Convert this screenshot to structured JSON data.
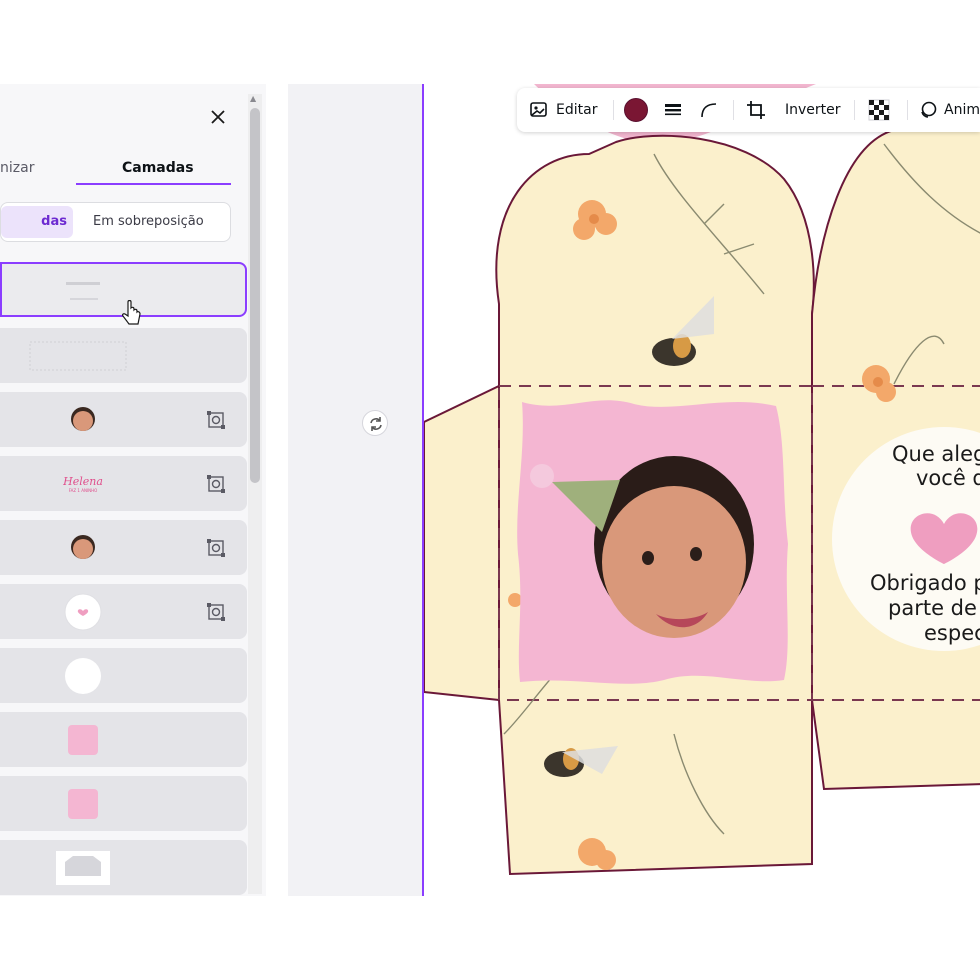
{
  "panel": {
    "tabs": [
      {
        "label": "nizar"
      },
      {
        "label": "Camadas"
      }
    ],
    "segments": [
      {
        "label": "das"
      },
      {
        "label": "Em sobreposição"
      }
    ],
    "more_label": "•••"
  },
  "toolbar": {
    "edit_label": "Editar",
    "color_swatch": "#7a1633",
    "flip_label": "Inverter",
    "animate_label": "Anim"
  },
  "design": {
    "greeting_line1": "Que aleg",
    "greeting_line2": "você d",
    "thanks_line1": "Obrigado p",
    "thanks_line2": "parte de",
    "thanks_line3": "espec",
    "layer_thumb_name": "Helena",
    "layer_thumb_sub": "FAZ 1 ANINHO"
  },
  "colors": {
    "accent": "#8b3dff",
    "pink": "#f4b6d2",
    "cream": "#fbf0cc",
    "outline": "#6a1838"
  }
}
